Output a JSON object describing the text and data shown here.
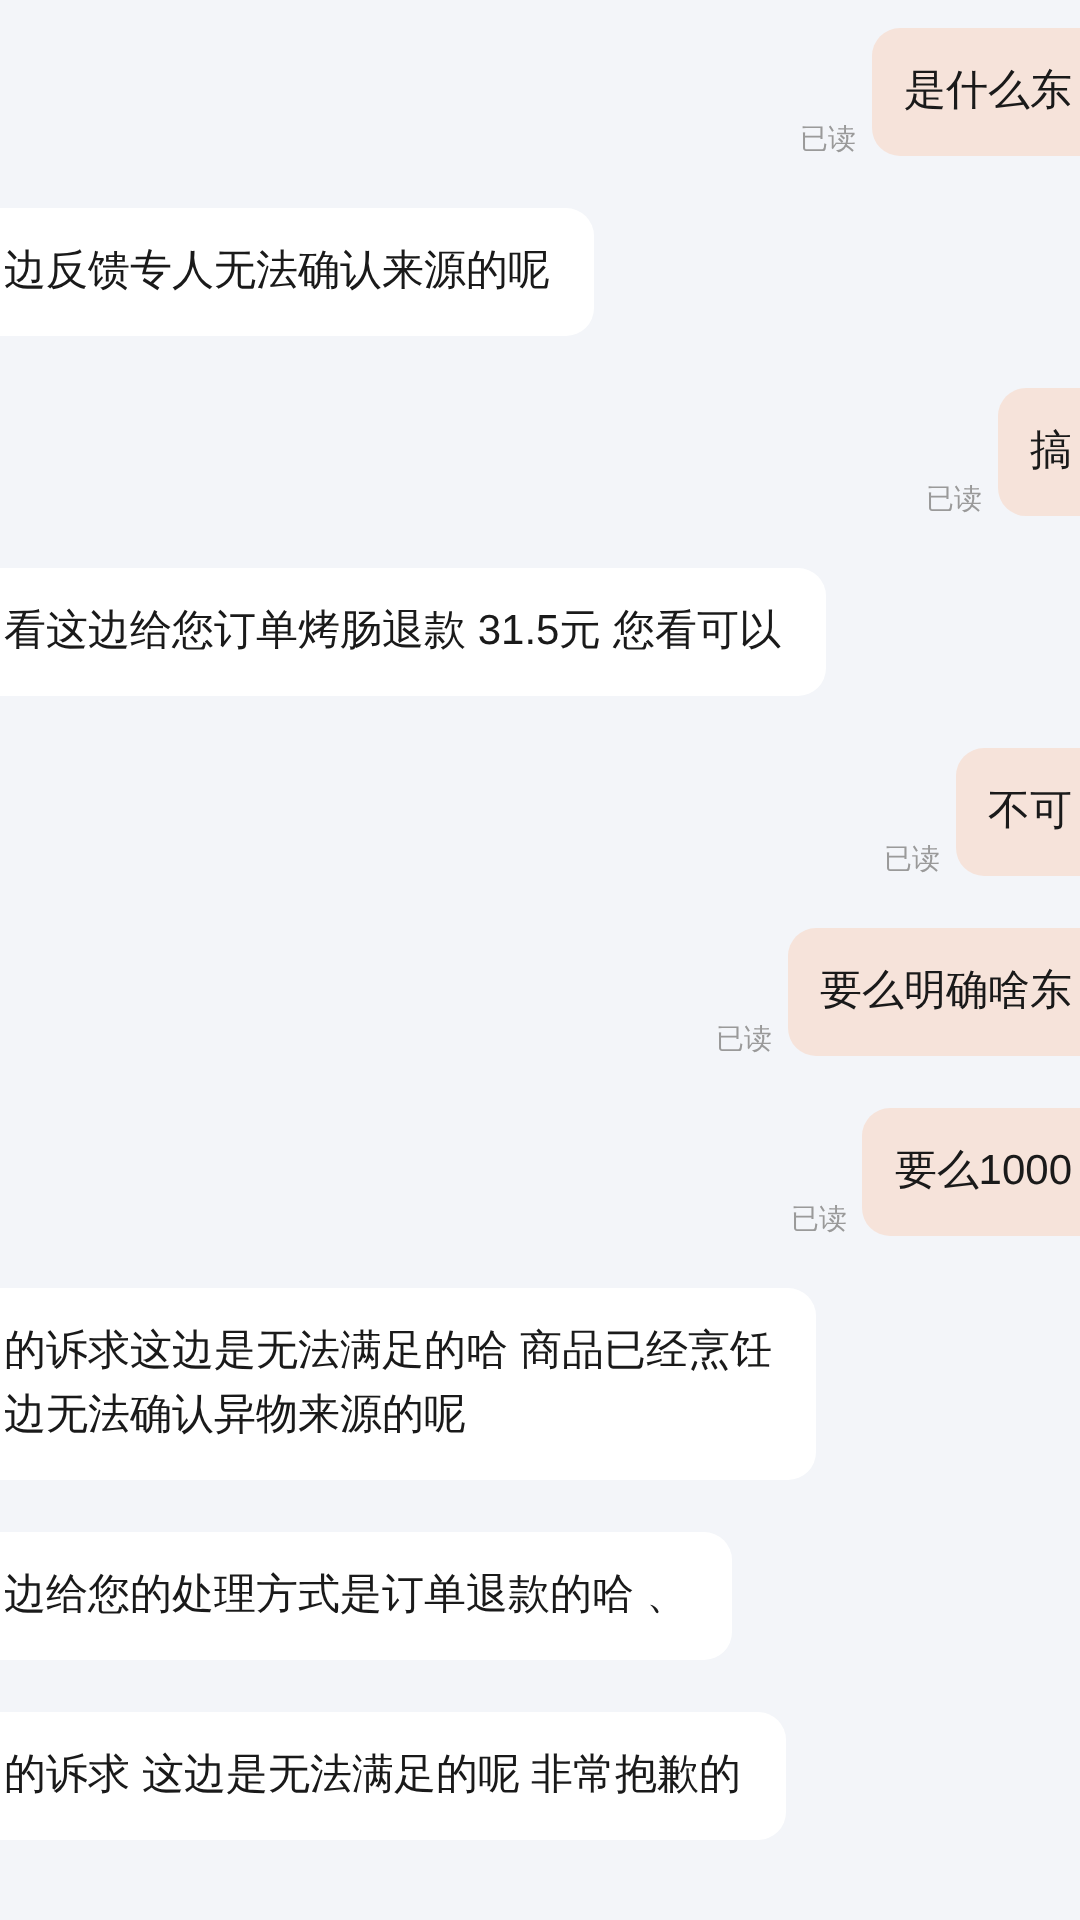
{
  "messages": [
    {
      "kind": "sent",
      "lines": [
        "是什么东"
      ],
      "receipt": "已读"
    },
    {
      "kind": "received",
      "lines": [
        "边反馈专人无法确认来源的呢"
      ]
    },
    {
      "kind": "sent",
      "lines": [
        "搞"
      ],
      "receipt": "已读"
    },
    {
      "kind": "received",
      "lines": [
        "看这边给您订单烤肠退款 31.5元  您看可以"
      ]
    },
    {
      "kind": "sent",
      "lines": [
        "不可"
      ],
      "receipt": "已读"
    },
    {
      "kind": "sent",
      "lines": [
        "要么明确啥东"
      ],
      "receipt": "已读"
    },
    {
      "kind": "sent",
      "lines": [
        "要么1000"
      ],
      "receipt": "已读"
    },
    {
      "kind": "received",
      "lines": [
        "的诉求这边是无法满足的哈 商品已经烹饪",
        "边无法确认异物来源的呢"
      ]
    },
    {
      "kind": "received",
      "lines": [
        "边给您的处理方式是订单退款的哈 、"
      ]
    },
    {
      "kind": "received",
      "lines": [
        "的诉求 这边是无法满足的呢 非常抱歉的"
      ]
    }
  ]
}
